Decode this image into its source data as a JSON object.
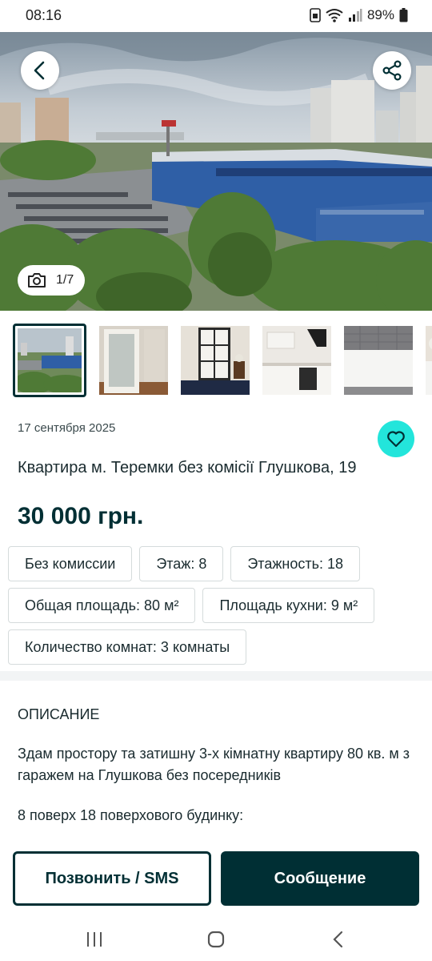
{
  "status_bar": {
    "time": "08:16",
    "battery": "89%",
    "icons": [
      "sim-icon",
      "wifi-icon",
      "signal-icon",
      "battery-icon"
    ]
  },
  "gallery": {
    "counter": "1/7",
    "thumbnails": [
      "street-view",
      "door",
      "wardrobe",
      "kitchen",
      "bed",
      "washer"
    ]
  },
  "listing": {
    "date": "17 сентября 2025",
    "title": "Квартира м. Теремки без комісії Глушкова, 19",
    "price": "30 000 грн.",
    "tags": [
      "Без комиссии",
      "Этаж: 8",
      "Этажность: 18",
      "Общая площадь: 80 м²",
      "Площадь кухни: 9 м²",
      "Количество комнат: 3 комнаты"
    ]
  },
  "description": {
    "heading": "ОПИСАНИЕ",
    "text": "Здам простору та затишну 3-х кімнатну квартиру 80 кв. м з гаражем на Глушкова без посередників",
    "line2": "8 поверх 18 поверхового будинку:",
    "more": "..."
  },
  "actions": {
    "call_label": "Позвонить / SMS",
    "message_label": "Сообщение"
  },
  "colors": {
    "primary": "#002f34",
    "accent": "#23e5db",
    "border": "#d5dbdc"
  }
}
